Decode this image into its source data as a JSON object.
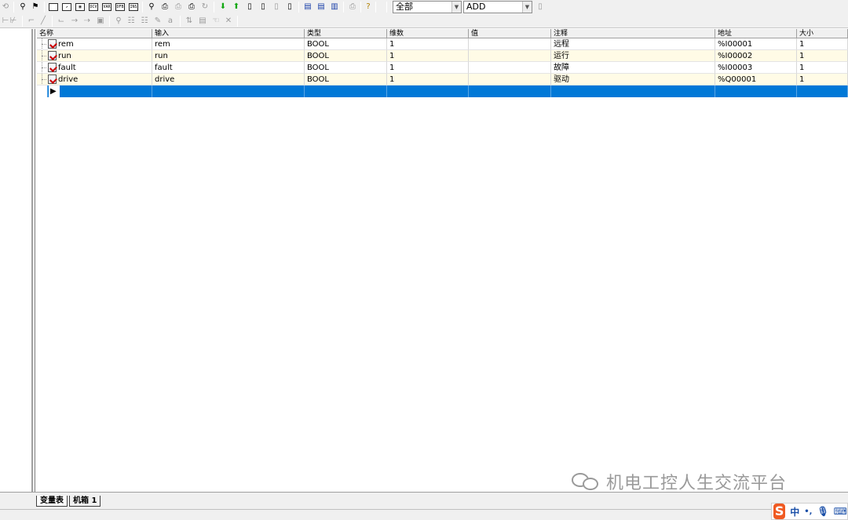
{
  "toolbar": {
    "icons": [
      "back-icon",
      "binoculars-icon",
      "find-replace-icon",
      "new-window-icon",
      "import-icon",
      "table-icon",
      "dcv-icon",
      "var-icon",
      "dfb-icon",
      "inst-icon",
      "zoom-icon",
      "print-preview-icon",
      "print-setup-icon",
      "print-icon",
      "refresh-icon",
      "arrow-down-icon",
      "arrow-up-icon",
      "insert-icon",
      "append-icon",
      "copy-icon",
      "paste-icon",
      "tile-icon",
      "split-icon",
      "window-icon",
      "print-small-icon",
      "help-icon"
    ],
    "mini_labels": {
      "dcv": "DCV",
      "var": "VAR",
      "dfb": "DFB",
      "inst": "INS"
    },
    "filter_combo": "全部",
    "add_combo": "ADD"
  },
  "table": {
    "columns": [
      "名称",
      "输入",
      "类型",
      "维数",
      "值",
      "注释",
      "地址",
      "大小"
    ],
    "rows": [
      {
        "name": "rem",
        "input": "rem",
        "type": "BOOL",
        "dim": "1",
        "value": "",
        "comment": "远程",
        "address": "%I00001",
        "size": "1"
      },
      {
        "name": "run",
        "input": "run",
        "type": "BOOL",
        "dim": "1",
        "value": "",
        "comment": "运行",
        "address": "%I00002",
        "size": "1"
      },
      {
        "name": "fault",
        "input": "fault",
        "type": "BOOL",
        "dim": "1",
        "value": "",
        "comment": "故障",
        "address": "%I00003",
        "size": "1"
      },
      {
        "name": "drive",
        "input": "drive",
        "type": "BOOL",
        "dim": "1",
        "value": "",
        "comment": "驱动",
        "address": "%Q00001",
        "size": "1"
      }
    ],
    "new_row_marker": "▶"
  },
  "sheet_tabs": [
    "变量表",
    "机箱 1"
  ],
  "watermark": "机电工控人生交流平台",
  "ime": {
    "logo": "S",
    "lang": "中",
    "punct": "•,"
  },
  "colors": {
    "selection": "#0078d7",
    "alt_row": "#fffbe6",
    "ime_logo": "#f05a22"
  }
}
